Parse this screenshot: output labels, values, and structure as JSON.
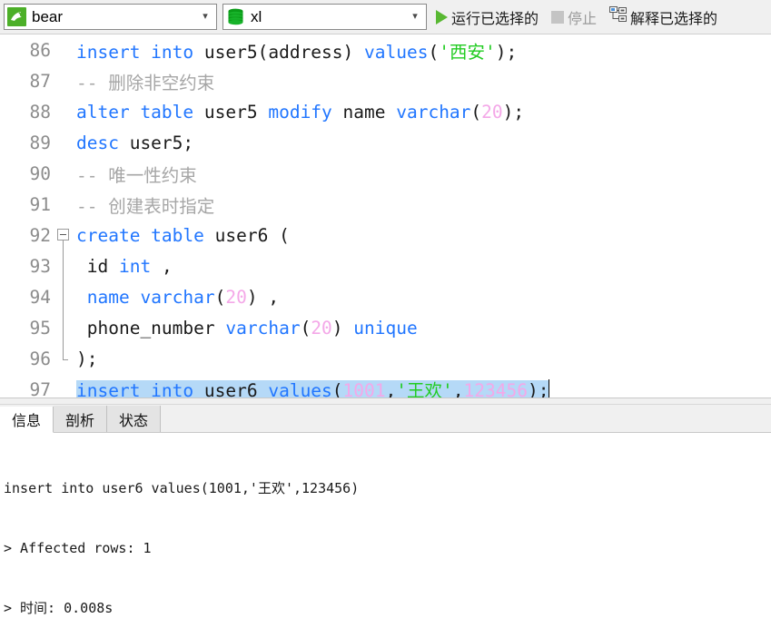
{
  "toolbar": {
    "connection": {
      "icon": "mysql-dolphin-icon",
      "value": "bear",
      "arrow": "chevron-down-icon"
    },
    "database": {
      "icon": "database-cylinder-icon",
      "value": "xl",
      "arrow": "chevron-down-icon"
    },
    "run_selected": {
      "label": "运行已选择的",
      "icon": "play-icon",
      "enabled": true
    },
    "stop": {
      "label": "停止",
      "icon": "stop-square-icon",
      "enabled": false
    },
    "explain_selected": {
      "label": "解释已选择的",
      "icon": "explain-tree-icon",
      "enabled": true
    }
  },
  "editor": {
    "lines": [
      {
        "n": "86",
        "tokens": [
          {
            "t": "insert into ",
            "c": "kw"
          },
          {
            "t": "user5",
            "c": "pun"
          },
          {
            "t": "(",
            "c": "pun"
          },
          {
            "t": "address",
            "c": "pun"
          },
          {
            "t": ") ",
            "c": "pun"
          },
          {
            "t": "values",
            "c": "kw"
          },
          {
            "t": "(",
            "c": "pun"
          },
          {
            "t": "'西安'",
            "c": "str"
          },
          {
            "t": ");",
            "c": "pun"
          }
        ]
      },
      {
        "n": "87",
        "tokens": [
          {
            "t": "-- 删除非空约束",
            "c": "cmt"
          }
        ]
      },
      {
        "n": "88",
        "tokens": [
          {
            "t": "alter table ",
            "c": "kw"
          },
          {
            "t": "user5 ",
            "c": "pun"
          },
          {
            "t": "modify ",
            "c": "kw"
          },
          {
            "t": "name ",
            "c": "pun"
          },
          {
            "t": "varchar",
            "c": "kw"
          },
          {
            "t": "(",
            "c": "pun"
          },
          {
            "t": "20",
            "c": "num"
          },
          {
            "t": ");",
            "c": "pun"
          }
        ]
      },
      {
        "n": "89",
        "tokens": [
          {
            "t": "desc ",
            "c": "kw"
          },
          {
            "t": "user5;",
            "c": "pun"
          }
        ]
      },
      {
        "n": "90",
        "tokens": [
          {
            "t": "-- 唯一性约束",
            "c": "cmt"
          }
        ]
      },
      {
        "n": "91",
        "tokens": [
          {
            "t": "-- 创建表时指定",
            "c": "cmt"
          }
        ]
      },
      {
        "n": "92",
        "fold": "start",
        "tokens": [
          {
            "t": "create table ",
            "c": "kw"
          },
          {
            "t": "user6 (",
            "c": "pun"
          }
        ]
      },
      {
        "n": "93",
        "fold": "mid",
        "tokens": [
          {
            "t": " id ",
            "c": "pun"
          },
          {
            "t": "int ",
            "c": "kw"
          },
          {
            "t": ",",
            "c": "pun"
          }
        ]
      },
      {
        "n": "94",
        "fold": "mid",
        "tokens": [
          {
            "t": " ",
            "c": "pun"
          },
          {
            "t": "name ",
            "c": "kw"
          },
          {
            "t": "varchar",
            "c": "kw"
          },
          {
            "t": "(",
            "c": "pun"
          },
          {
            "t": "20",
            "c": "num"
          },
          {
            "t": ") ,",
            "c": "pun"
          }
        ]
      },
      {
        "n": "95",
        "fold": "mid",
        "tokens": [
          {
            "t": " phone_number ",
            "c": "pun"
          },
          {
            "t": "varchar",
            "c": "kw"
          },
          {
            "t": "(",
            "c": "pun"
          },
          {
            "t": "20",
            "c": "num"
          },
          {
            "t": ") ",
            "c": "pun"
          },
          {
            "t": "unique",
            "c": "kw"
          }
        ]
      },
      {
        "n": "96",
        "fold": "end",
        "tokens": [
          {
            "t": ");",
            "c": "pun"
          }
        ]
      },
      {
        "n": "97",
        "selected": true,
        "caret": true,
        "tokens": [
          {
            "t": "insert into ",
            "c": "kw"
          },
          {
            "t": "user6 ",
            "c": "pun"
          },
          {
            "t": "values",
            "c": "kw"
          },
          {
            "t": "(",
            "c": "pun"
          },
          {
            "t": "1001",
            "c": "num"
          },
          {
            "t": ",",
            "c": "pun"
          },
          {
            "t": "'王欢'",
            "c": "str"
          },
          {
            "t": ",",
            "c": "pun"
          },
          {
            "t": "123456",
            "c": "num"
          },
          {
            "t": ");",
            "c": "pun"
          }
        ]
      }
    ]
  },
  "results": {
    "tabs": [
      {
        "label": "信息",
        "active": true
      },
      {
        "label": "剖析",
        "active": false
      },
      {
        "label": "状态",
        "active": false
      }
    ],
    "output_lines": [
      "insert into user6 values(1001,'王欢',123456)",
      "> Affected rows: 1",
      "> 时间: 0.008s"
    ]
  },
  "colors": {
    "keyword": "#2176ff",
    "string": "#22cc22",
    "number": "#f4a8e8",
    "comment": "#a6a6a6",
    "selection": "#b5d9f7",
    "accent_green": "#4caf28"
  }
}
